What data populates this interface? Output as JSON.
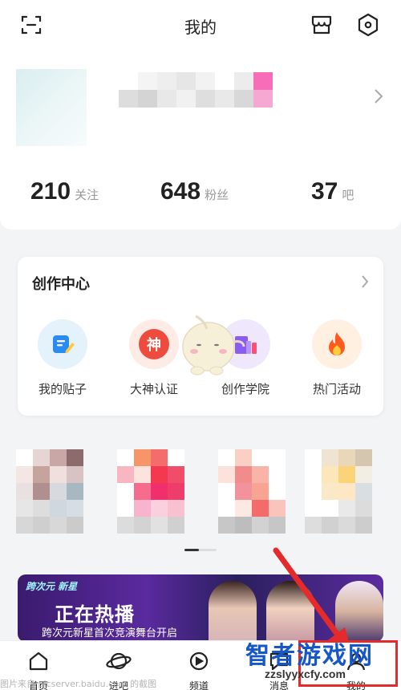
{
  "header": {
    "title": "我的",
    "scan_icon": "scan-icon",
    "store_icon": "shop-icon",
    "settings_icon": "settings-hex-icon"
  },
  "profile": {
    "stats": [
      {
        "value": "210",
        "label": "关注"
      },
      {
        "value": "648",
        "label": "粉丝"
      },
      {
        "value": "37",
        "label": "吧"
      }
    ]
  },
  "creator_center": {
    "title": "创作中心",
    "tools": [
      {
        "label": "我的贴子",
        "icon": "edit-note-icon",
        "color": "#2b8bf2",
        "bg": "#e3f2fb"
      },
      {
        "label": "大神认证",
        "icon": "god-badge-icon",
        "glyph": "神",
        "color": "#ee4b3f",
        "bg": "#fdece6"
      },
      {
        "label": "创作学院",
        "icon": "academy-icon",
        "color": "#8a5cf0",
        "bg": "#efe8fd"
      },
      {
        "label": "热门活动",
        "icon": "flame-icon",
        "color": "#ff5a1f",
        "bg": "#fff0e2"
      }
    ]
  },
  "banner": {
    "tag": "跨次元 新星",
    "headline": "正在热播",
    "subtitle": "跨次元新星首次竞演舞台开启"
  },
  "bottom_nav": [
    {
      "label": "首页",
      "icon": "home-icon"
    },
    {
      "label": "进吧",
      "icon": "planet-icon"
    },
    {
      "label": "频道",
      "icon": "channel-icon"
    },
    {
      "label": "消息",
      "icon": "message-icon"
    },
    {
      "label": "我的",
      "icon": "profile-icon"
    }
  ],
  "watermark": {
    "source_text": "图片来自 picserver.baidu.com 的截图",
    "logo_text": "智者游戏网",
    "logo_url": "zzslyyxcfy.com"
  },
  "colors": {
    "accent": "#e42a2a",
    "background": "#f3f4f6"
  }
}
